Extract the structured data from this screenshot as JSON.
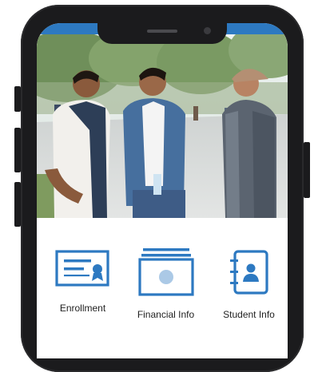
{
  "accent_color": "#2d79c1",
  "hero": {
    "image": "three-students-talking-on-campus"
  },
  "tiles": [
    {
      "label": "Enrollment",
      "icon": "certificate-icon"
    },
    {
      "label": "Financial Info",
      "icon": "money-icon"
    },
    {
      "label": "Student Info",
      "icon": "contact-book-icon"
    }
  ]
}
